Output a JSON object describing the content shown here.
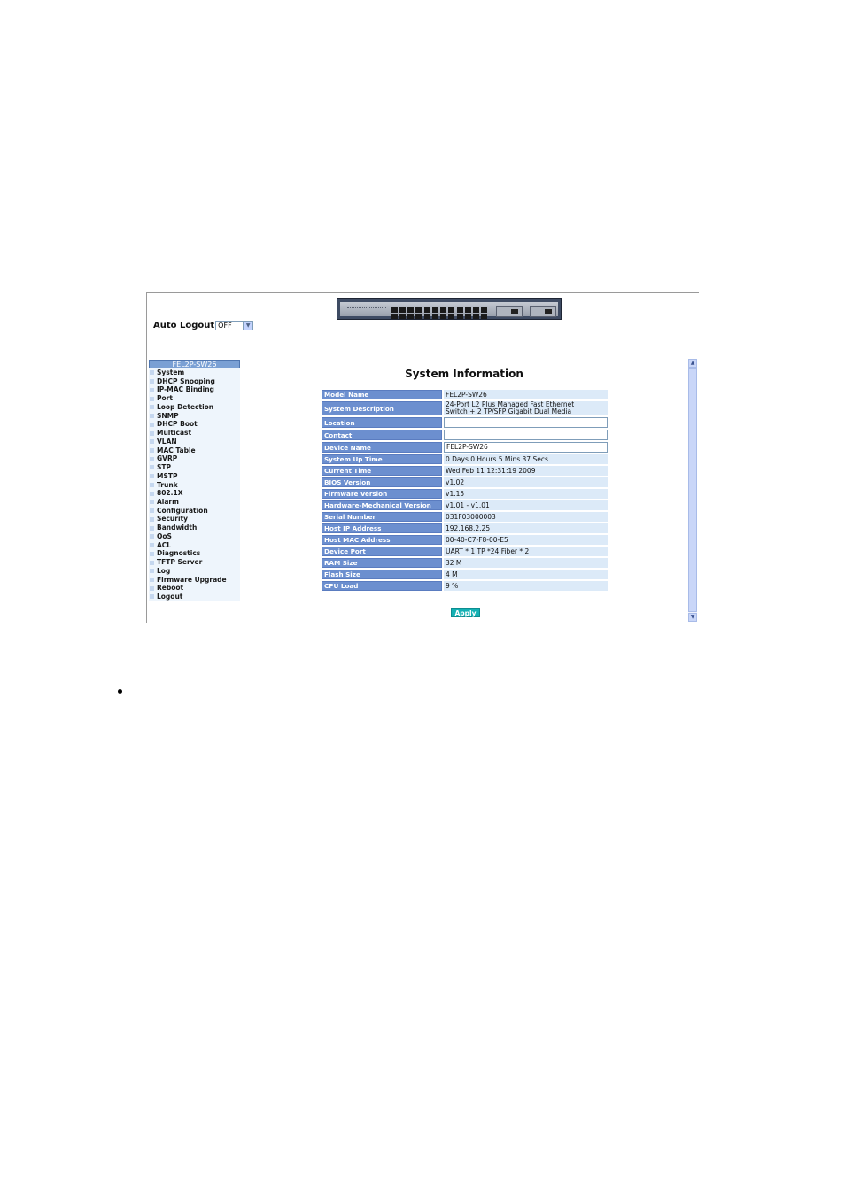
{
  "auto_logout": {
    "label": "Auto Logout",
    "selected": "OFF"
  },
  "nav": {
    "header": "FEL2P-SW26",
    "items": [
      "System",
      "DHCP Snooping",
      "IP-MAC Binding",
      "Port",
      "Loop Detection",
      "SNMP",
      "DHCP Boot",
      "Multicast",
      "VLAN",
      "MAC Table",
      "GVRP",
      "STP",
      "MSTP",
      "Trunk",
      "802.1X",
      "Alarm",
      "Configuration",
      "Security",
      "Bandwidth",
      "QoS",
      "ACL",
      "Diagnostics",
      "TFTP Server",
      "Log",
      "Firmware Upgrade",
      "Reboot",
      "Logout"
    ]
  },
  "main": {
    "title": "System Information",
    "rows": [
      {
        "label": "Model Name",
        "value": "FEL2P-SW26",
        "input": false
      },
      {
        "label": "System Description",
        "value": "24-Port L2 Plus Managed Fast Ethernet\nSwitch + 2 TP/SFP Gigabit Dual Media",
        "input": false
      },
      {
        "label": "Location",
        "value": "",
        "input": true
      },
      {
        "label": "Contact",
        "value": "",
        "input": true
      },
      {
        "label": "Device Name",
        "value": "FEL2P-SW26",
        "input": true
      },
      {
        "label": "System Up Time",
        "value": "0 Days 0 Hours 5 Mins 37 Secs",
        "input": false
      },
      {
        "label": "Current Time",
        "value": "Wed Feb 11 12:31:19 2009",
        "input": false
      },
      {
        "label": "BIOS Version",
        "value": "v1.02",
        "input": false
      },
      {
        "label": "Firmware Version",
        "value": "v1.15",
        "input": false
      },
      {
        "label": "Hardware-Mechanical Version",
        "value": "v1.01 - v1.01",
        "input": false
      },
      {
        "label": "Serial Number",
        "value": "031F03000003",
        "input": false
      },
      {
        "label": "Host IP Address",
        "value": "192.168.2.25",
        "input": false
      },
      {
        "label": "Host MAC Address",
        "value": "00-40-C7-F8-00-E5",
        "input": false
      },
      {
        "label": "Device Port",
        "value": "UART * 1 TP *24 Fiber * 2",
        "input": false
      },
      {
        "label": "RAM Size",
        "value": "32 M",
        "input": false
      },
      {
        "label": "Flash Size",
        "value": "4 M",
        "input": false
      },
      {
        "label": "CPU Load",
        "value": "9 %",
        "input": false
      }
    ],
    "apply_label": "Apply"
  },
  "colors": {
    "label_bg": "#6c8fcf",
    "value_bg": "#dceaf8",
    "apply_bg": "#14b1b4",
    "nav_header_bg": "#7aa0d4"
  },
  "icons": {
    "select_arrow": "chevron-down-icon",
    "scroll_up": "chevron-up-icon",
    "scroll_down": "chevron-down-icon"
  }
}
